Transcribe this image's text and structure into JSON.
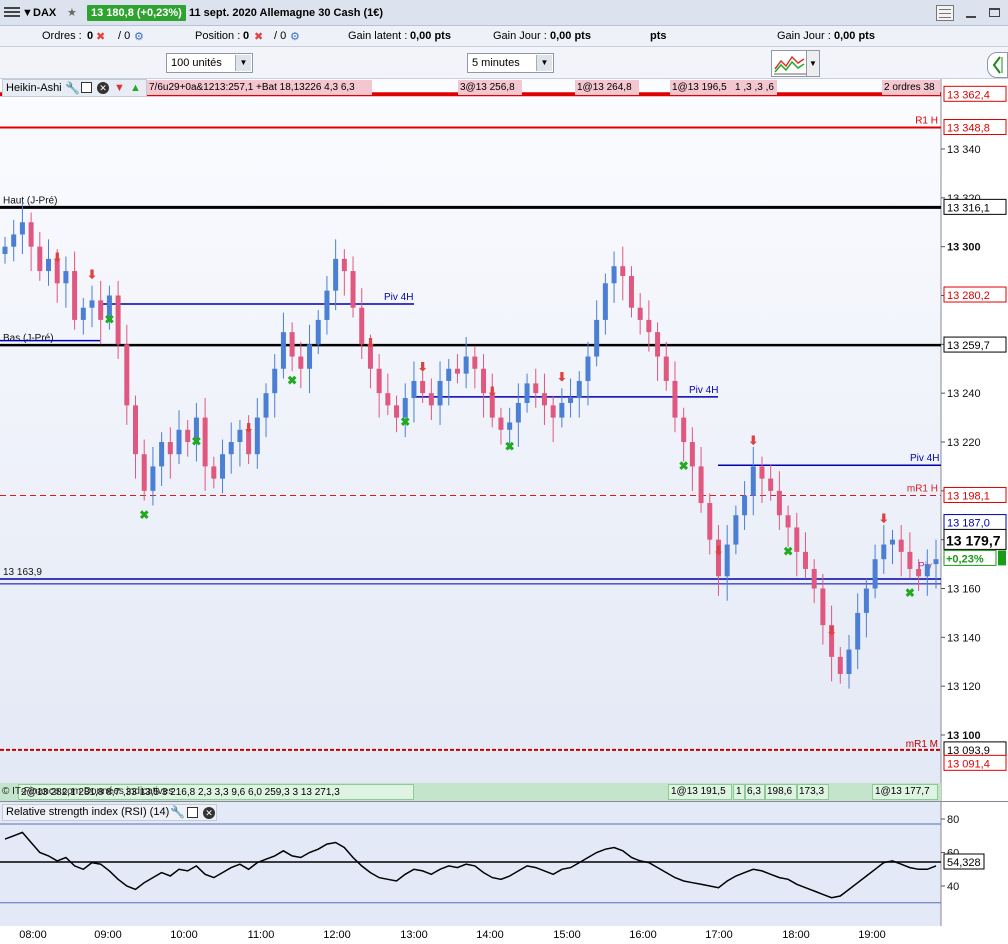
{
  "titlebar": {
    "symbol": "DAX",
    "price_change": "13 180,8 (+0,23%)",
    "date_instrument": "11 sept. 2020 Allemagne 30 Cash (1€)"
  },
  "stats": {
    "orders_label": "Ordres :",
    "orders_value": "0",
    "orders_value2": "/ 0",
    "position_label": "Position :",
    "position_value": "0",
    "position_value2": "/ 0",
    "gain_latent_label": "Gain latent :",
    "gain_latent_value": "0,00 pts",
    "gain_jour_label": "Gain Jour :",
    "gain_jour_value": "0,00 pts",
    "pts_fragment": "pts",
    "gain_jour2_label": "Gain Jour :",
    "gain_jour2_value": "0,00 pts"
  },
  "controls": {
    "quantity": "100 unités",
    "timeframe": "5 minutes"
  },
  "main_panel": {
    "indicator_name": "Heikin-Ashi",
    "top_overlay_text": "7/6u29+0a&1213:257,1 +Bat 18,13226 4,3 6,3",
    "top_ticket_1": "3@13 256,8",
    "top_ticket_2": "1@13 264,8",
    "top_ticket_3": "1@13 196,5",
    "top_ticket_3b": "1 ,3 ,3 ,6",
    "top_ticket_4": "2 ordres 38",
    "copyright": "© IT-Finance.com Données indicatives",
    "bottom_tickets": [
      "1@13 191,5",
      "1",
      "6,3",
      "198,6",
      "173,3",
      "1@13 177,7"
    ],
    "bottom_left_text": "2@13 282,1 281,8 8,7 ,33 13,5 3 216,8 2,3 3,3 9,6 6,0 259,3 3 13 271,3",
    "line_labels": {
      "r1": "R1 H",
      "haut": "Haut (J-Pré)",
      "bas": "Bas (J-Pré)",
      "piv4h_1": "Piv 4H",
      "piv4h_2": "Piv 4H",
      "piv4h_3": "Piv 4H",
      "mr1h": "mR1 H",
      "mr1m": "mR1 M",
      "piv_small": "Piv",
      "level_163": "13 163,9"
    },
    "price_axis": {
      "ticks": [
        "13 340",
        "13 320",
        "13 300",
        "13 280",
        "13 260",
        "13 240",
        "13 220",
        "13 200",
        "13 180",
        "13 160",
        "13 140",
        "13 120",
        "13 100"
      ],
      "boxes": {
        "b1": "13 362,4",
        "b2": "13 348,8",
        "b3": "13 316,1",
        "b4": "13 280,2",
        "b5": "13 259,7",
        "b6": "13 198,1",
        "b7": "13 187,0",
        "current": "13 179,7",
        "pct": "+0,23%",
        "b8": "13 093,9",
        "b9": "13 091,4"
      }
    }
  },
  "rsi_panel": {
    "name": "Relative strength index (RSI) (14)",
    "levels": [
      "80",
      "60",
      "40"
    ],
    "current_value": "54,328"
  },
  "time_axis": [
    "08:00",
    "09:00",
    "10:00",
    "11:00",
    "12:00",
    "13:00",
    "14:00",
    "15:00",
    "16:00",
    "17:00",
    "18:00",
    "19:00"
  ],
  "colors": {
    "bull": "#4a7fd4",
    "bear": "#e0577f",
    "r1": "#e00000",
    "pivot": "#0000b0",
    "level": "#000000",
    "buy_signal": "#1faa1f",
    "sell_signal": "#e04040"
  },
  "chart_data": {
    "type": "candlestick",
    "title": "Allemagne 30 Cash (1€)",
    "timeframe": "5 minutes",
    "ylim": [
      13090,
      13365
    ],
    "x_ticks": [
      "08:00",
      "09:00",
      "10:00",
      "11:00",
      "12:00",
      "13:00",
      "14:00",
      "15:00",
      "16:00",
      "17:00",
      "18:00",
      "19:00"
    ],
    "close_path": [
      13300,
      13305,
      13310,
      13300,
      13290,
      13295,
      13285,
      13290,
      13270,
      13275,
      13278,
      13270,
      13280,
      13260,
      13235,
      13215,
      13200,
      13210,
      13220,
      13215,
      13225,
      13220,
      13230,
      13210,
      13205,
      13215,
      13220,
      13225,
      13215,
      13230,
      13240,
      13250,
      13265,
      13255,
      13250,
      13260,
      13270,
      13282,
      13295,
      13290,
      13275,
      13260,
      13250,
      13240,
      13235,
      13230,
      13238,
      13245,
      13240,
      13235,
      13245,
      13250,
      13248,
      13255,
      13250,
      13240,
      13230,
      13225,
      13228,
      13236,
      13244,
      13240,
      13235,
      13230,
      13236,
      13238,
      13245,
      13255,
      13270,
      13285,
      13292,
      13288,
      13275,
      13270,
      13265,
      13255,
      13245,
      13230,
      13220,
      13210,
      13195,
      13180,
      13165,
      13178,
      13190,
      13198,
      13210,
      13205,
      13200,
      13190,
      13185,
      13175,
      13168,
      13160,
      13145,
      13132,
      13125,
      13135,
      13150,
      13160,
      13172,
      13178,
      13180,
      13175,
      13168,
      13165,
      13170,
      13172
    ],
    "levels": [
      {
        "name": "R1 H",
        "value": 13348.8
      },
      {
        "name": "Haut (J-Pré)",
        "value": 13316.1
      },
      {
        "name": "Bas (J-Pré)",
        "value": 13259.7
      },
      {
        "name": "mR1 H",
        "value": 13198.1
      },
      {
        "name": "13 163,9",
        "value": 13163.9
      },
      {
        "name": "mR1 M",
        "value": 13093.9
      }
    ],
    "last": 13179.7,
    "change_pct": "+0,23%",
    "rsi": {
      "levels": [
        80,
        60,
        40
      ],
      "last": 54.328,
      "values": [
        68,
        70,
        72,
        66,
        60,
        58,
        55,
        57,
        52,
        50,
        54,
        53,
        49,
        44,
        40,
        38,
        42,
        45,
        48,
        46,
        50,
        49,
        52,
        47,
        45,
        48,
        51,
        53,
        50,
        54,
        56,
        58,
        61,
        58,
        57,
        60,
        62,
        65,
        66,
        63,
        57,
        52,
        48,
        45,
        44,
        43,
        47,
        50,
        49,
        47,
        50,
        52,
        51,
        53,
        52,
        48,
        45,
        44,
        46,
        49,
        52,
        51,
        49,
        47,
        50,
        51,
        54,
        57,
        60,
        62,
        63,
        61,
        57,
        55,
        54,
        51,
        48,
        45,
        43,
        42,
        41,
        40,
        39,
        43,
        46,
        48,
        50,
        49,
        47,
        45,
        44,
        41,
        39,
        37,
        35,
        33,
        34,
        38,
        42,
        46,
        50,
        54,
        55,
        53,
        51,
        50,
        50,
        52
      ]
    }
  }
}
